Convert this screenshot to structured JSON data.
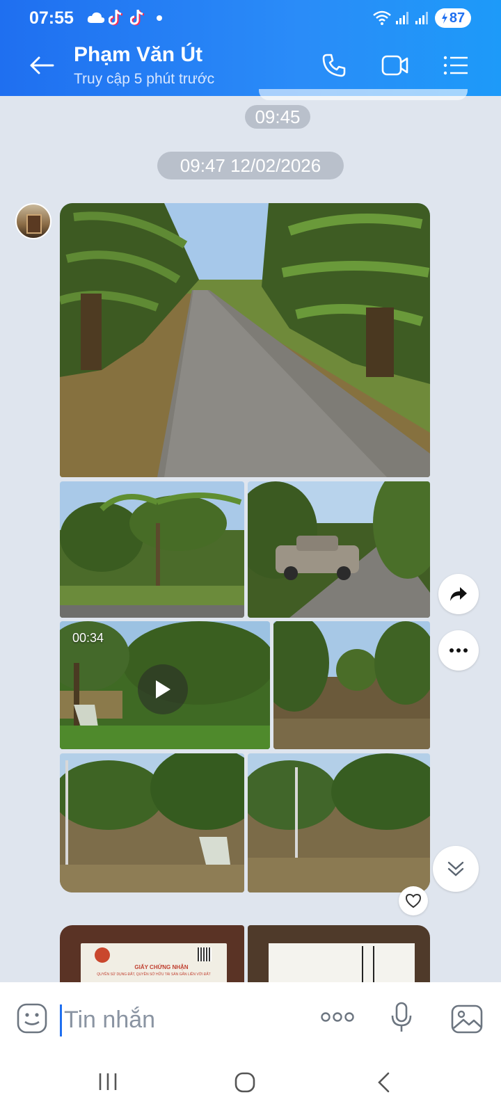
{
  "status_bar": {
    "time": "07:55",
    "battery": "87",
    "icons": [
      "cloud-icon",
      "tiktok-icon",
      "tiktok-icon",
      "dot-icon",
      "wifi-icon",
      "signal-icon",
      "signal-icon",
      "battery-icon"
    ]
  },
  "header": {
    "contact_name": "Phạm Văn Út",
    "contact_status": "Truy cập 5 phút trước",
    "icons": [
      "back-arrow-icon",
      "phone-icon",
      "video-call-icon",
      "menu-list-icon"
    ]
  },
  "chat": {
    "time_chip": "09:45",
    "date_chip": "09:47 12/02/2026",
    "video_duration": "00:34",
    "document_title": "GIẤY CHỨNG NHẬN",
    "document_subtitle": "QUYỀN SỬ DỤNG ĐẤT, QUYỀN SỞ HỮU TÀI SẢN GẮN LIỀN VỚI ĐẤT"
  },
  "composer": {
    "placeholder": "Tin nhắn",
    "icons": [
      "emoji-icon",
      "more-icon",
      "microphone-icon",
      "gallery-icon"
    ]
  },
  "nav_bar": {
    "icons": [
      "recent-apps-icon",
      "home-icon",
      "back-icon"
    ]
  },
  "colors": {
    "header_blue": "#1f6ff0",
    "chat_background": "#dfe5ee",
    "chip_gray": "#b9c0cb"
  }
}
